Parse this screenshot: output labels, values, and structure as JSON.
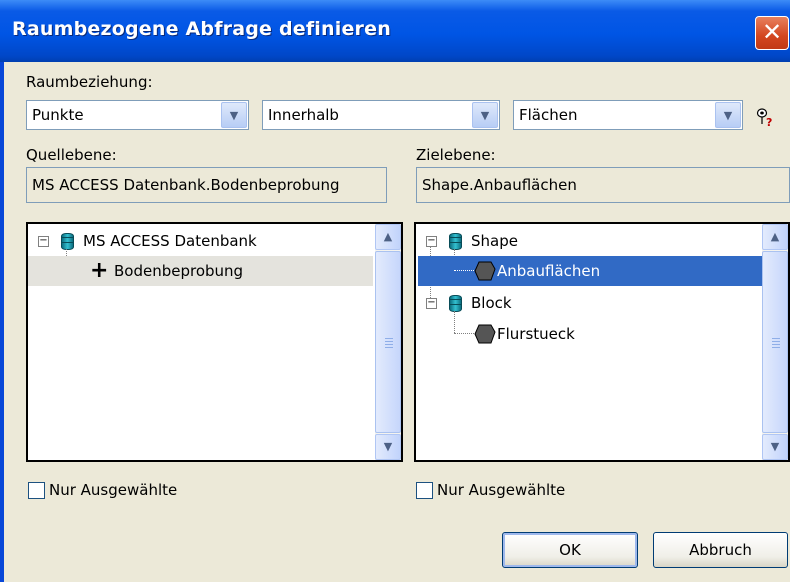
{
  "window": {
    "title": "Raumbezogene Abfrage definieren",
    "close_glyph": "✕"
  },
  "relation": {
    "label": "Raumbeziehung:",
    "source_geom": "Punkte",
    "operator": "Innerhalb",
    "target_geom": "Flächen"
  },
  "source": {
    "label": "Quellebene:",
    "value": "MS ACCESS Datenbank.Bodenbeprobung",
    "tree": {
      "root": "MS ACCESS Datenbank",
      "child": "Bodenbeprobung"
    },
    "only_selected": "Nur Ausgewählte"
  },
  "target": {
    "label": "Zielebene:",
    "value": "Shape.Anbauflächen",
    "tree": {
      "root1": "Shape",
      "child1": "Anbauflächen",
      "root2": "Block",
      "child2": "Flurstueck"
    },
    "only_selected": "Nur Ausgewählte"
  },
  "buttons": {
    "ok": "OK",
    "cancel": "Abbruch"
  },
  "icons": {
    "help": "help-question-icon",
    "database": "database-icon",
    "polygon": "polygon-layer-icon",
    "point": "point-layer-icon"
  }
}
